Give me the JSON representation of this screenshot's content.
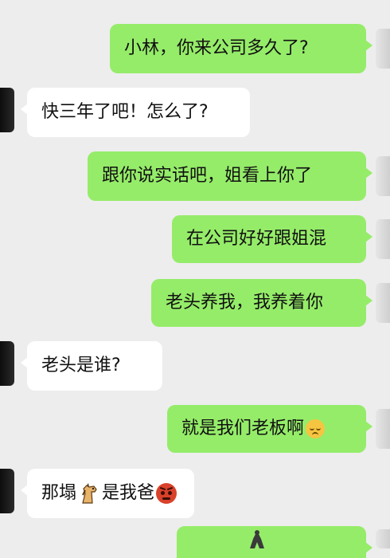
{
  "messages": [
    {
      "side": "sent",
      "text": "小林，你来公司多久了?"
    },
    {
      "side": "recv",
      "text": "快三年了吧！怎么了?"
    },
    {
      "side": "sent",
      "text": "跟你说实话吧，姐看上你了"
    },
    {
      "side": "sent",
      "text": "在公司好好跟姐混"
    },
    {
      "side": "sent",
      "text": "老头养我，我养着你"
    },
    {
      "side": "recv",
      "text": "老头是谁?"
    },
    {
      "side": "sent",
      "text": "就是我们老板啊",
      "emoji": "pensive-face-icon"
    },
    {
      "side": "recv",
      "text_before": "那塌",
      "text_after": "是我爸",
      "inline_icon": "horse-icon",
      "emoji": "angry-face-icon"
    }
  ],
  "colors": {
    "background": "#ededed",
    "sent_bubble": "#95ec69",
    "recv_bubble": "#ffffff"
  }
}
